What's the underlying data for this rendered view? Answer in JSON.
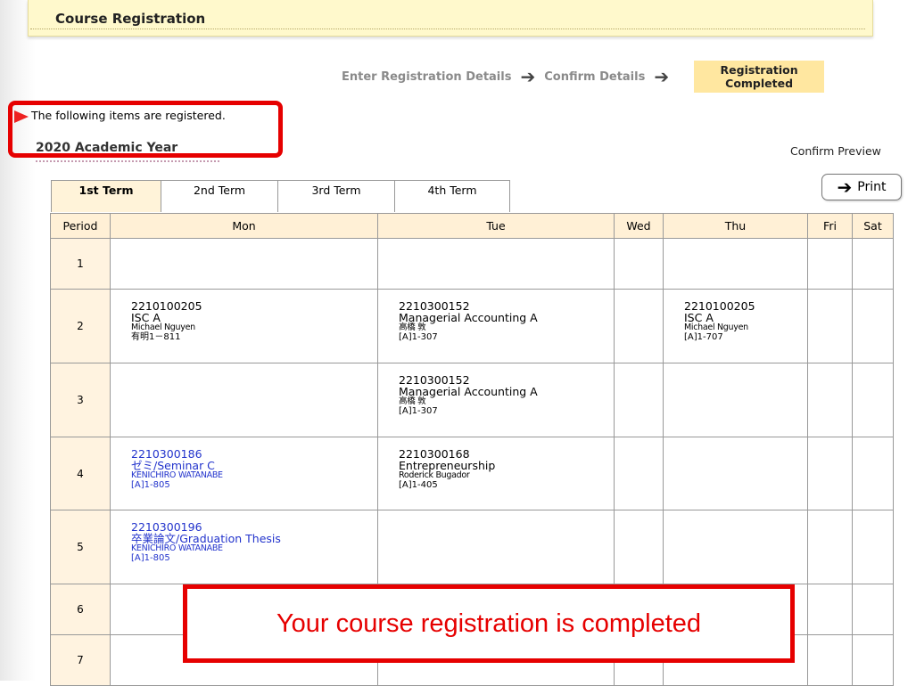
{
  "header": {
    "title": "Course Registration"
  },
  "steps": {
    "step1": "Enter Registration Details",
    "step2": "Confirm Details",
    "current_line1": "Registration",
    "current_line2": "Completed"
  },
  "notice": "The following items are registered.",
  "year_label": "2020 Academic Year",
  "confirm_preview": "Confirm Preview",
  "print_label": "Print",
  "tabs": [
    "1st Term",
    "2nd Term",
    "3rd Term",
    "4th Term"
  ],
  "timetable": {
    "headers": [
      "Period",
      "Mon",
      "Tue",
      "Wed",
      "Thu",
      "Fri",
      "Sat"
    ],
    "periods": [
      "1",
      "2",
      "3",
      "4",
      "5",
      "6",
      "7"
    ],
    "courses": {
      "p2_mon": {
        "code": "2210100205",
        "name": "ISC A",
        "teacher": "Michael Nguyen",
        "room": "有明1－811"
      },
      "p2_tue": {
        "code": "2210300152",
        "name": "Managerial Accounting A",
        "teacher": "高橋 敦",
        "room": "[A]1-307"
      },
      "p2_thu": {
        "code": "2210100205",
        "name": "ISC A",
        "teacher": "Michael Nguyen",
        "room": "[A]1-707"
      },
      "p3_tue": {
        "code": "2210300152",
        "name": "Managerial Accounting A",
        "teacher": "高橋 敦",
        "room": "[A]1-307"
      },
      "p4_mon": {
        "code": "2210300186",
        "name": "ゼミ/Seminar C",
        "teacher": "KENICHIRO WATANABE",
        "room": "[A]1-805"
      },
      "p4_tue": {
        "code": "2210300168",
        "name": "Entrepreneurship",
        "teacher": "Roderick Bugador",
        "room": "[A]1-405"
      },
      "p5_mon": {
        "code": "2210300196",
        "name": "卒業論文/Graduation Thesis",
        "teacher": "KENICHIRO WATANABE",
        "room": "[A]1-805"
      }
    }
  },
  "banner": "Your course registration is completed",
  "colors": {
    "highlight_red": "#e60000",
    "header_bg": "#fff9cc",
    "current_step_bg": "#ffe7a0",
    "link_blue": "#2233cc"
  }
}
